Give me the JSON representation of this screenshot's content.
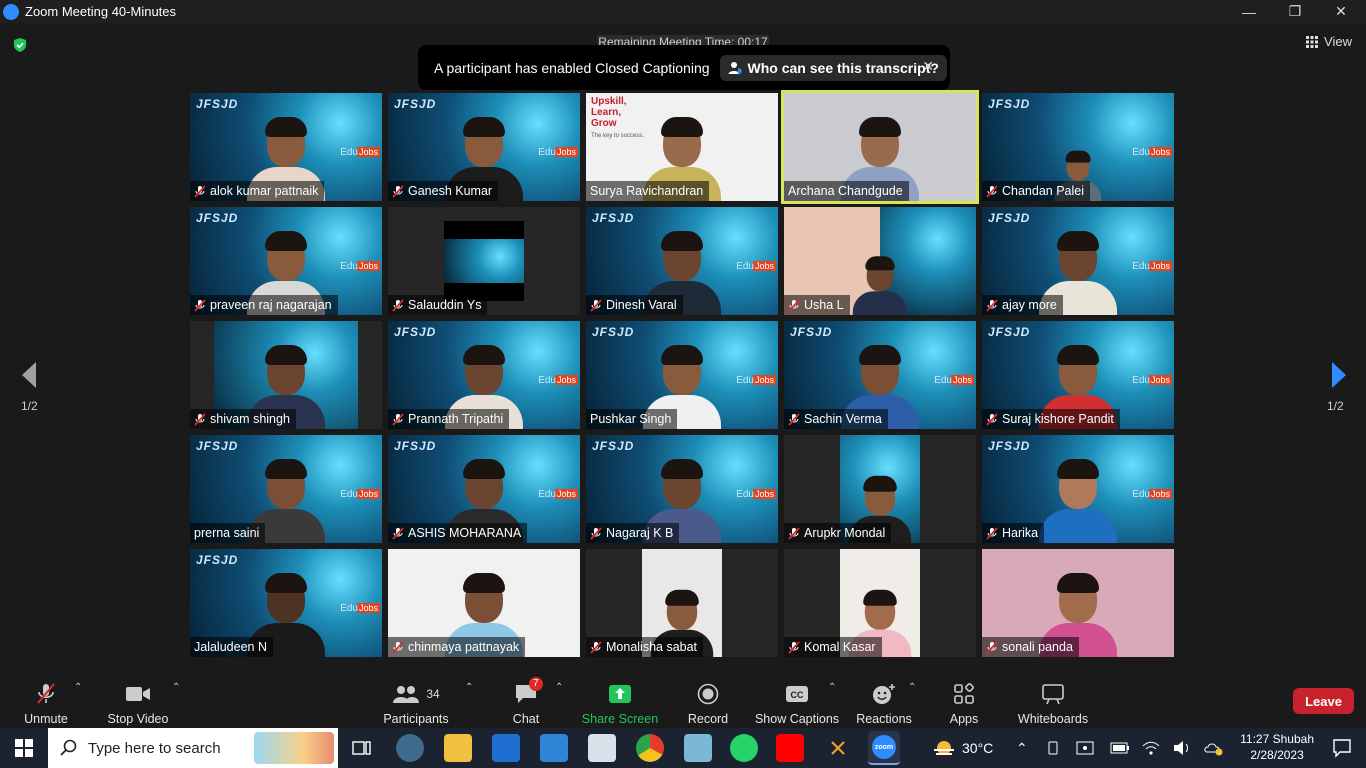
{
  "window": {
    "title": "Zoom Meeting 40-Minutes"
  },
  "meeting": {
    "remaining_time": "Remaining Meeting Time: 00:17",
    "view_label": "View",
    "notice_text": "A participant has enabled Closed Captioning",
    "notice_button": "Who can see this transcript?",
    "page_left": "1/2",
    "page_right": "1/2"
  },
  "participants": [
    {
      "name": "alok kumar pattnaik",
      "muted": true
    },
    {
      "name": "Ganesh Kumar",
      "muted": true
    },
    {
      "name": "Surya Ravichandran",
      "muted": false
    },
    {
      "name": "Archana Chandgude",
      "muted": false
    },
    {
      "name": "Chandan Palei",
      "muted": true
    },
    {
      "name": "praveen raj nagarajan",
      "muted": true
    },
    {
      "name": "Salauddin Ys",
      "muted": true
    },
    {
      "name": "Dinesh Varal",
      "muted": true
    },
    {
      "name": "Usha L",
      "muted": true
    },
    {
      "name": "ajay more",
      "muted": true
    },
    {
      "name": "shivam shingh",
      "muted": true
    },
    {
      "name": "Prannath Tripathi",
      "muted": true
    },
    {
      "name": "Pushkar Singh",
      "muted": false
    },
    {
      "name": "Sachin Verma",
      "muted": true
    },
    {
      "name": "Suraj kishore Pandit",
      "muted": true
    },
    {
      "name": "prerna saini",
      "muted": false
    },
    {
      "name": "ASHIS MOHARANA",
      "muted": true
    },
    {
      "name": "Nagaraj K B",
      "muted": true
    },
    {
      "name": "Arupkr Mondal",
      "muted": true
    },
    {
      "name": "Harika",
      "muted": true
    },
    {
      "name": "Jalaludeen N",
      "muted": false
    },
    {
      "name": "chinmaya pattnayak",
      "muted": true
    },
    {
      "name": "Monalisha sabat",
      "muted": true
    },
    {
      "name": "Komal Kasar",
      "muted": true
    },
    {
      "name": "sonali panda",
      "muted": true
    }
  ],
  "tile_texts": {
    "surya_banner": "Upskill, Learn, Grow",
    "surya_tagline": "The key to success.",
    "jobs": "Jobs"
  },
  "toolbar": {
    "unmute": "Unmute",
    "stop_video": "Stop Video",
    "participants": "Participants",
    "participants_count": "34",
    "chat": "Chat",
    "chat_badge": "7",
    "share_screen": "Share Screen",
    "record": "Record",
    "show_captions": "Show Captions",
    "reactions": "Reactions",
    "apps": "Apps",
    "whiteboards": "Whiteboards",
    "leave": "Leave"
  },
  "taskbar": {
    "search_placeholder": "Type here to search",
    "temperature": "30°C",
    "time": "11:27 Shubah",
    "date": "2/28/2023"
  },
  "colors": {
    "share_green": "#23c45e",
    "leave_red": "#c8232c",
    "active_speaker": "#d7e55a",
    "nav_blue": "#2d8cff"
  }
}
